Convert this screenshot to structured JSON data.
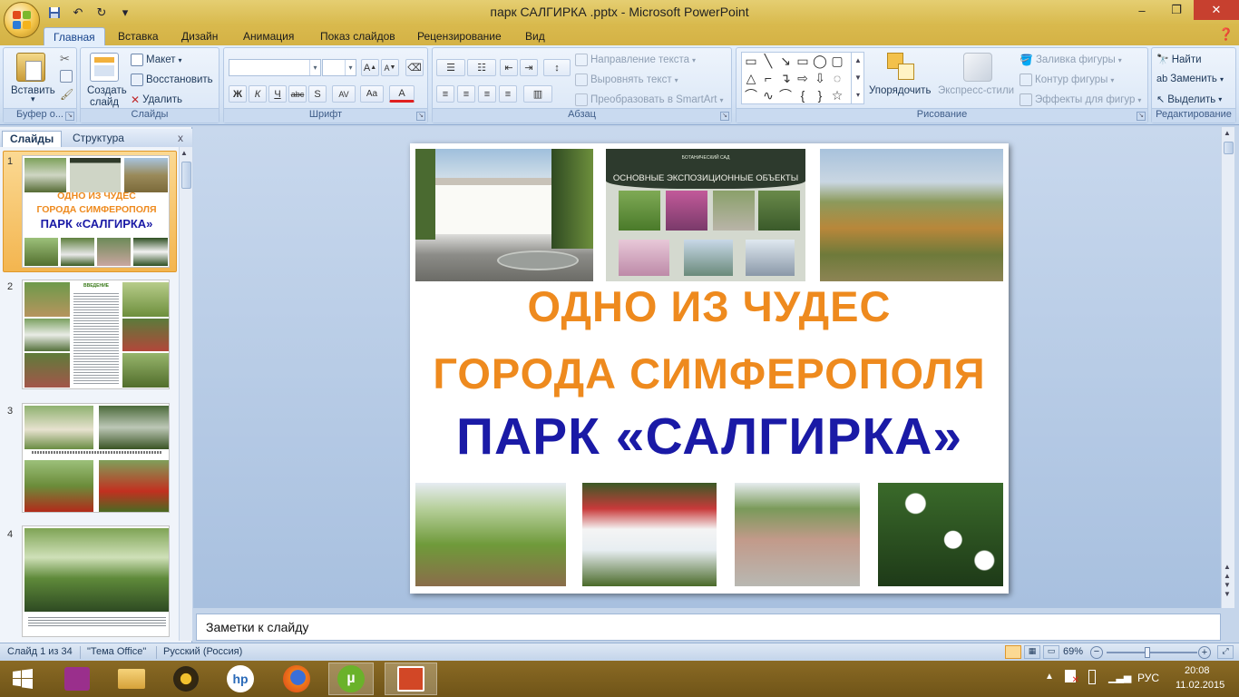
{
  "window": {
    "title": "парк САЛГИРКА .pptx - Microsoft PowerPoint",
    "controls": [
      "–",
      "❐",
      "✕"
    ]
  },
  "qat": {
    "save": "save-icon",
    "undo": "↶",
    "redo": "↻",
    "customize": "▾"
  },
  "tabs": [
    "Главная",
    "Вставка",
    "Дизайн",
    "Анимация",
    "Показ слайдов",
    "Рецензирование",
    "Вид"
  ],
  "ribbon": {
    "clipboard": {
      "paste": "Вставить",
      "label": "Буфер о..."
    },
    "slides": {
      "new_slide_l1": "Создать",
      "new_slide_l2": "слайд",
      "layout": "Макет",
      "reset": "Восстановить",
      "delete": "Удалить",
      "label": "Слайды"
    },
    "font": {
      "label": "Шрифт",
      "bold": "Ж",
      "italic": "К",
      "underline": "Ч",
      "strike": "abc",
      "shadow": "S",
      "spacing": "AV",
      "case": "Aa",
      "color": "A",
      "grow": "A",
      "shrink": "A"
    },
    "paragraph": {
      "text_direction": "Направление текста",
      "align_text": "Выровнять текст",
      "smartart": "Преобразовать в SmartArt",
      "label": "Абзац"
    },
    "drawing": {
      "arrange": "Упорядочить",
      "quick_styles": "Экспресс-стили",
      "fill": "Заливка фигуры",
      "outline": "Контур фигуры",
      "effects": "Эффекты для фигур",
      "label": "Рисование"
    },
    "editing": {
      "find": "Найти",
      "replace": "Заменить",
      "select": "Выделить",
      "label": "Редактирование"
    }
  },
  "pane": {
    "tab_slides": "Слайды",
    "tab_outline": "Структура",
    "close": "x",
    "thumbs": [
      {
        "num": "1",
        "line1": "ОДНО ИЗ ЧУДЕС",
        "line2": "ГОРОДА СИМФЕРОПОЛЯ",
        "line3": "ПАРК «САЛГИРКА»"
      },
      {
        "num": "2",
        "title": "ВВЕДЕНИЕ"
      },
      {
        "num": "3"
      },
      {
        "num": "4"
      }
    ]
  },
  "slide": {
    "line1": "ОДНО ИЗ ЧУДЕС",
    "line2": "ГОРОДА СИМФЕРОПОЛЯ",
    "line3": "ПАРК «САЛГИРКА»",
    "sign_header": "ОСНОВНЫЕ ЭКСПОЗИЦИОННЫЕ ОБЪЕКТЫ",
    "sign_small": "БОТАНИЧЕСКИЙ САД",
    "colors": {
      "orange": "#ee8a1e",
      "blue": "#1a1aa6"
    }
  },
  "notes": {
    "placeholder": "Заметки к слайду"
  },
  "status": {
    "slide": "Слайд 1 из 34",
    "theme": "\"Тема Office\"",
    "language": "Русский (Россия)",
    "zoom": "69%",
    "zoom_fraction": 0.45
  },
  "taskbar": {
    "lang": "РУС",
    "time": "20:08",
    "date": "11.02.2015"
  }
}
